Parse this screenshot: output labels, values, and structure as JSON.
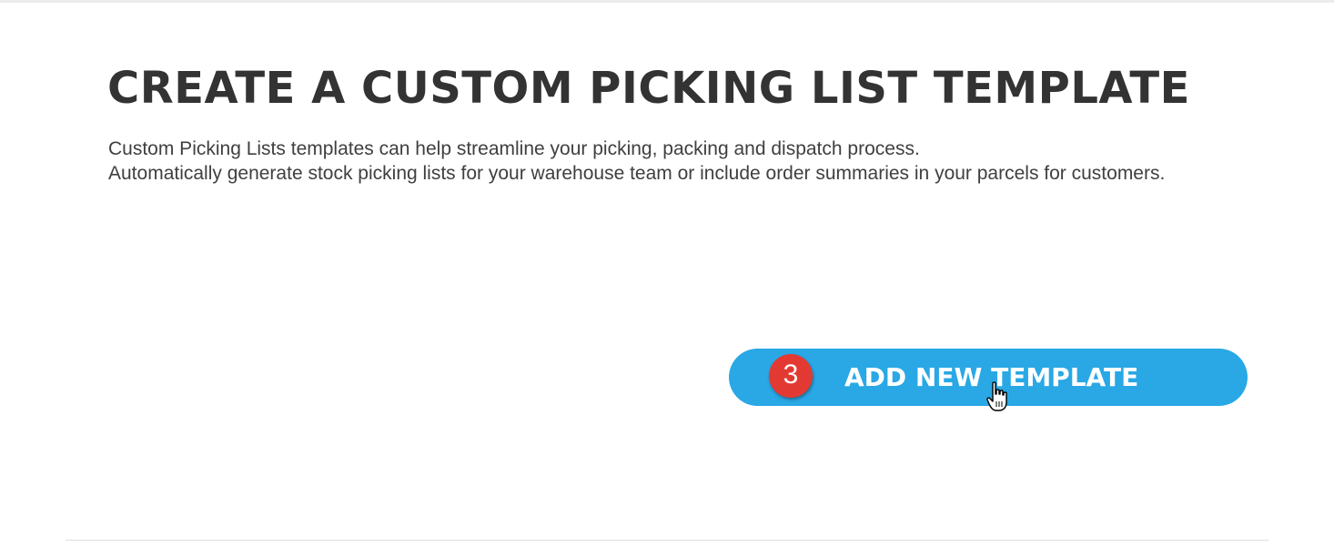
{
  "page": {
    "title": "CREATE A CUSTOM PICKING LIST TEMPLATE",
    "intro_lines": [
      "Custom Picking Lists templates can help streamline your picking, packing and dispatch process.",
      "Automatically generate stock picking lists for your warehouse team or include order summaries in your parcels for customers."
    ]
  },
  "actions": {
    "add_template_label": "ADD NEW TEMPLATE",
    "step_number": "3"
  },
  "icons": {
    "cursor": "hand-pointer-icon"
  },
  "colors": {
    "button": "#29a8e5",
    "badge": "#e23a32",
    "heading": "#333333"
  }
}
